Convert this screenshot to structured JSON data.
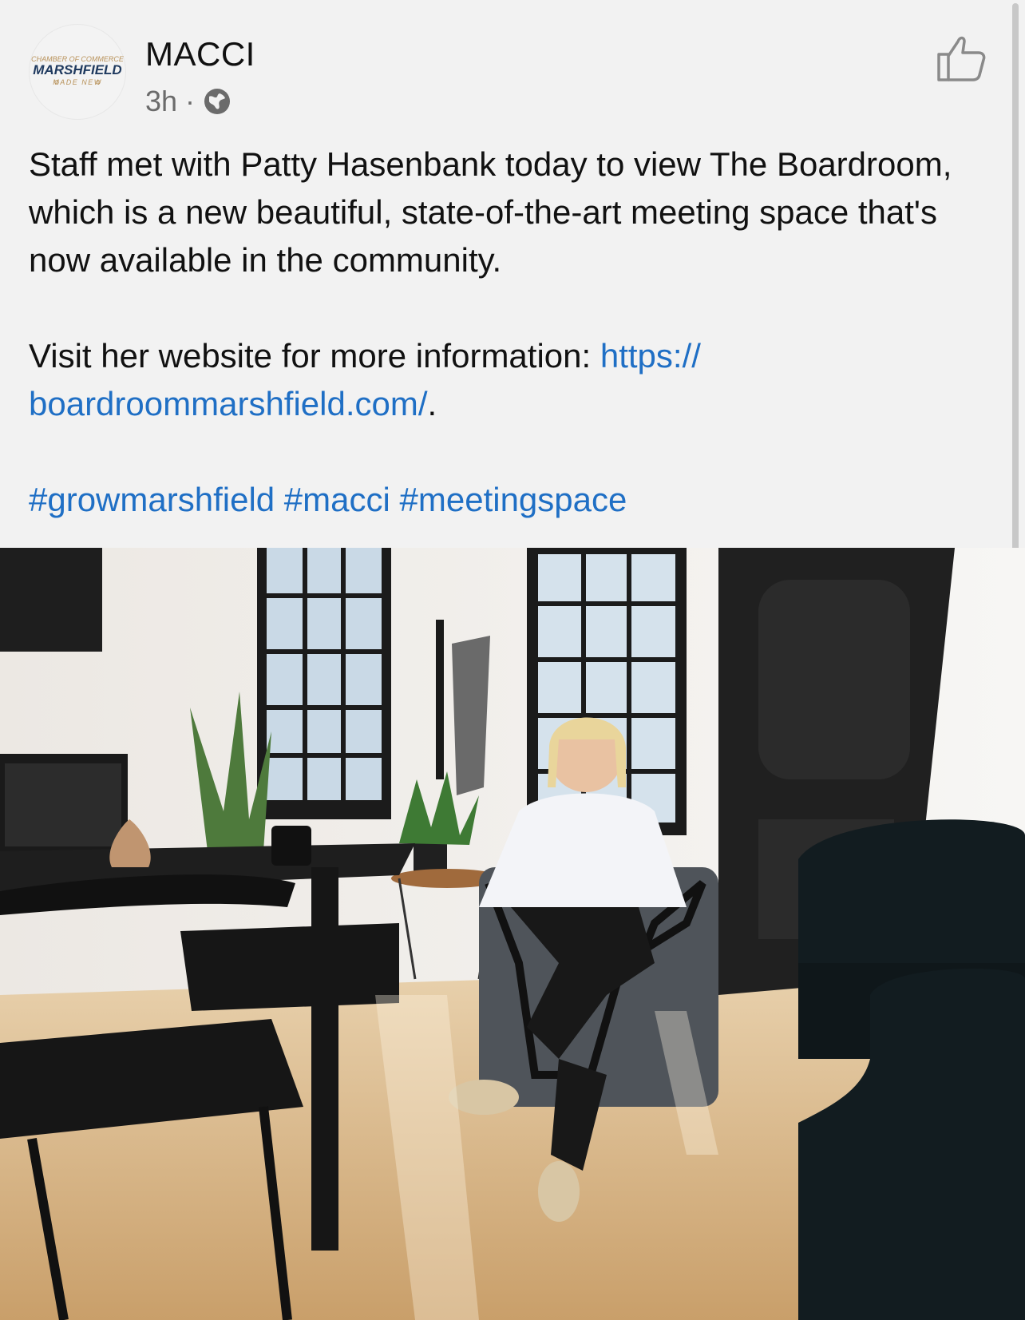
{
  "post": {
    "page_name": "MACCI",
    "time": "3h",
    "separator": "·",
    "privacy_icon": "globe-icon",
    "like_icon": "thumbs-up-icon",
    "logo": {
      "top": "CHAMBER OF COMMERCE",
      "main": "MARSHFIELD",
      "bottom": "MADE NEW"
    },
    "text_paragraph_1": "Staff met with Patty Hasenbank today to view The Boardroom, which is a new beautiful, state-of-the-art meeting space that's now available in the community.",
    "text_paragraph_2_prefix": "Visit her website for more information: ",
    "link_line_1": "https://",
    "link_line_2": "boardroommarshfield.com/",
    "link_suffix": ".",
    "hashtags": "#growmarshfield #macci #meetingspace"
  },
  "colors": {
    "background": "#f2f2f2",
    "link": "#1f6fc5",
    "text": "#111111",
    "meta": "#6b6b6b"
  }
}
